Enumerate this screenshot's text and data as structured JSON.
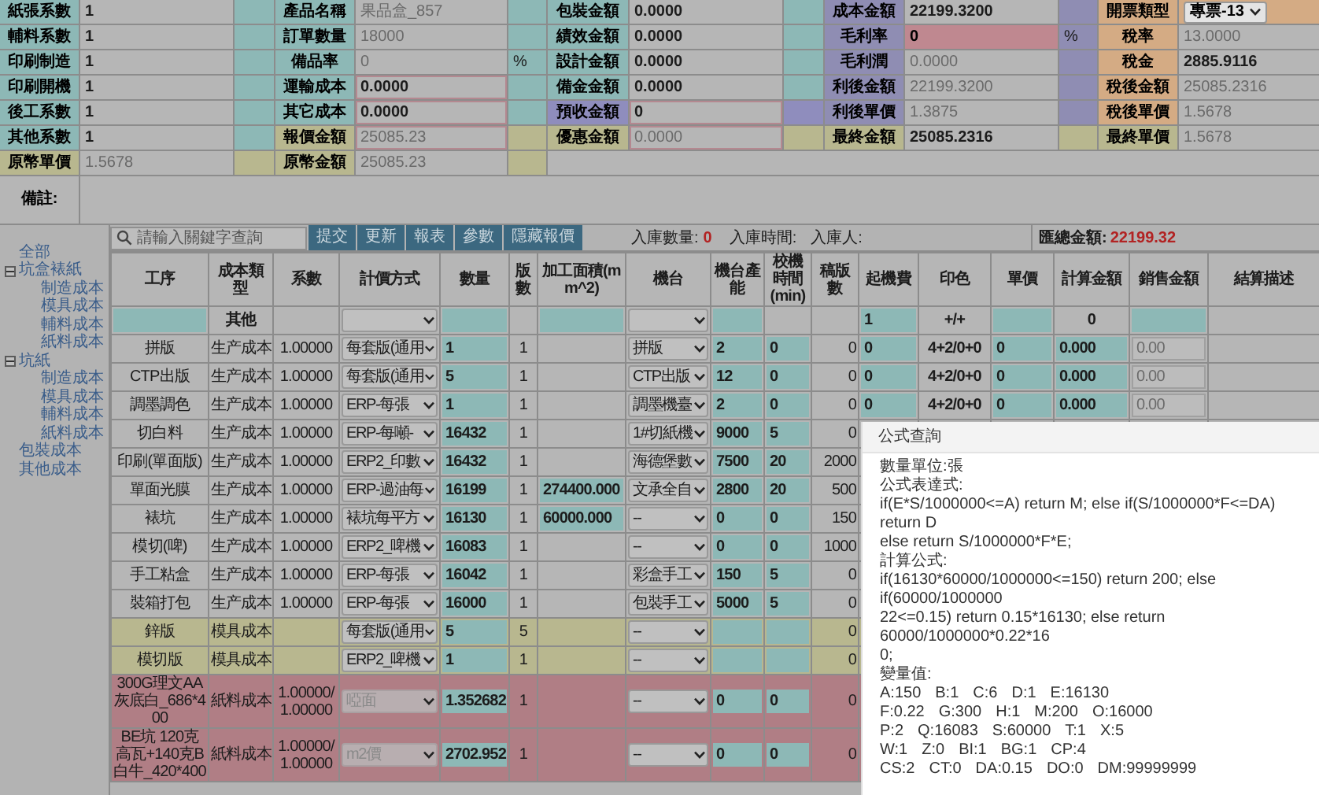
{
  "form": {
    "rows": [
      [
        {
          "label": "紙張系數",
          "kind": "basic",
          "value": "1",
          "readonly": false
        },
        {
          "label": "產品名稱",
          "kind": "basic",
          "value": "果品盒_857",
          "readonly": true
        },
        {
          "label": "包裝金額",
          "kind": "basic",
          "value": "0.0000",
          "readonly": false
        },
        {
          "label": "成本金額",
          "kind": "profit",
          "value": "22199.3200",
          "readonly": false
        },
        {
          "label": "開票類型",
          "kind": "tax",
          "value": "專票-13",
          "readonly": false,
          "dropdown": true
        }
      ],
      [
        {
          "label": "輔料系數",
          "kind": "basic",
          "value": "1",
          "readonly": false
        },
        {
          "label": "訂單數量",
          "kind": "basic",
          "value": "18000",
          "readonly": true
        },
        {
          "label": "績效金額",
          "kind": "basic",
          "value": "0.0000",
          "readonly": false
        },
        {
          "label": "毛利率",
          "kind": "profit",
          "value": "0",
          "readonly": false,
          "alert": true,
          "unit": "%"
        },
        {
          "label": "稅率",
          "kind": "tax",
          "value": "13.0000",
          "readonly": true
        }
      ],
      [
        {
          "label": "印刷制造",
          "kind": "basic",
          "value": "1",
          "readonly": false
        },
        {
          "label": "備品率",
          "kind": "basic",
          "value": "0",
          "readonly": true,
          "unit": "%"
        },
        {
          "label": "設計金額",
          "kind": "basic",
          "value": "0.0000",
          "readonly": false
        },
        {
          "label": "毛利潤",
          "kind": "profit",
          "value": "0.0000",
          "readonly": true
        },
        {
          "label": "稅金",
          "kind": "tax",
          "value": "2885.9116",
          "readonly": false
        }
      ],
      [
        {
          "label": "印刷開機",
          "kind": "basic",
          "value": "1",
          "readonly": false
        },
        {
          "label": "運輸成本",
          "kind": "basic",
          "value": "0.0000",
          "readonly": false,
          "bordered": true
        },
        {
          "label": "備金金額",
          "kind": "basic",
          "value": "0.0000",
          "readonly": false
        },
        {
          "label": "利後金額",
          "kind": "profit",
          "value": "22199.3200",
          "readonly": true
        },
        {
          "label": "稅後金額",
          "kind": "tax",
          "value": "25085.2316",
          "readonly": true
        }
      ],
      [
        {
          "label": "後工系數",
          "kind": "basic",
          "value": "1",
          "readonly": false
        },
        {
          "label": "其它成本",
          "kind": "basic",
          "value": "0.0000",
          "readonly": false,
          "bordered": true
        },
        {
          "label": "預收金額",
          "kind": "prepaid",
          "value": "0",
          "readonly": false,
          "bordered": true
        },
        {
          "label": "利後單價",
          "kind": "profit",
          "value": "1.3875",
          "readonly": true
        },
        {
          "label": "稅後單價",
          "kind": "tax",
          "value": "1.5678",
          "readonly": true
        }
      ],
      [
        {
          "label": "其他系數",
          "kind": "basic",
          "value": "1",
          "readonly": false
        },
        {
          "label": "報價金額",
          "kind": "final",
          "value": "25085.23",
          "readonly": true,
          "bordered": true
        },
        {
          "label": "優惠金額",
          "kind": "final",
          "value": "0.0000",
          "readonly": true,
          "bordered": true
        },
        {
          "label": "最終金額",
          "kind": "final",
          "value": "25085.2316",
          "readonly": false
        },
        {
          "label": "最終單價",
          "kind": "final",
          "value": "1.5678",
          "readonly": true
        }
      ],
      [
        {
          "label": "原幣單價",
          "kind": "final",
          "value": "1.5678",
          "readonly": true
        },
        {
          "label": "原幣金額",
          "kind": "final",
          "value": "25085.23",
          "readonly": true
        }
      ]
    ],
    "remark_label": "備註:"
  },
  "sidebar": {
    "tree": [
      {
        "label": "全部"
      },
      {
        "label": "坑盒裱紙",
        "expanded": true,
        "children": [
          {
            "label": "制造成本"
          },
          {
            "label": "模具成本"
          },
          {
            "label": "輔料成本"
          },
          {
            "label": "紙料成本"
          }
        ]
      },
      {
        "label": "坑紙",
        "expanded": true,
        "children": [
          {
            "label": "制造成本"
          },
          {
            "label": "模具成本"
          },
          {
            "label": "輔料成本"
          },
          {
            "label": "紙料成本"
          }
        ]
      },
      {
        "label": "包裝成本"
      },
      {
        "label": "其他成本"
      }
    ]
  },
  "toolbar": {
    "search": {
      "placeholder": "請輸入關鍵字查詢"
    },
    "buttons": [
      "提交",
      "更新",
      "報表",
      "參數",
      "隱藏報價"
    ],
    "stock_quantity_label": "入庫數量:",
    "stock_quantity": "0",
    "stock_time_label": "入庫時間:",
    "stock_person_label": "入庫人:",
    "total_label": "匯總金額:",
    "total": "22199.32"
  },
  "table": {
    "columns": [
      "工序",
      "成本類型",
      "系數",
      "計價方式",
      "數量",
      "版數",
      "加工面積(mm^2)",
      "機台",
      "機台產能",
      "校機時間(min)",
      "稿版數",
      "起機費",
      "印色",
      "單價",
      "計算金額",
      "銷售金額",
      "結算描述"
    ],
    "filter_row": {
      "cost_type": "其他",
      "start_fee": "1",
      "print_colors": "+/+",
      "calc_amount": "0"
    },
    "rows": [
      {
        "kind": "production",
        "process": "拼版",
        "cost_type": "生产成本",
        "coefficient": "1.00000",
        "pricing_method": "每套版(通用",
        "pricing_disabled": false,
        "quantity": "1",
        "plates": "1",
        "machine": "拼版",
        "capacity": "2",
        "setup_time": "0",
        "draft_plates": "0",
        "start_fee": "0",
        "print_colors": "4+2/0+0",
        "unit_price": "0",
        "calc_amount": "0.000",
        "sales_amount": "0.00"
      },
      {
        "kind": "production",
        "process": "CTP出版",
        "cost_type": "生产成本",
        "coefficient": "1.00000",
        "pricing_method": "每套版(通用",
        "pricing_disabled": false,
        "quantity": "5",
        "plates": "1",
        "machine": "CTP出版",
        "capacity": "12",
        "setup_time": "0",
        "draft_plates": "0",
        "start_fee": "0",
        "print_colors": "4+2/0+0",
        "unit_price": "0",
        "calc_amount": "0.000",
        "sales_amount": "0.00"
      },
      {
        "kind": "production",
        "process": "調墨調色",
        "cost_type": "生产成本",
        "coefficient": "1.00000",
        "pricing_method": "ERP-每張",
        "pricing_disabled": false,
        "quantity": "1",
        "plates": "1",
        "machine": "調墨機臺",
        "capacity": "2",
        "setup_time": "0",
        "draft_plates": "0",
        "start_fee": "0",
        "print_colors": "4+2/0+0",
        "unit_price": "0",
        "calc_amount": "0.000",
        "sales_amount": "0.00"
      },
      {
        "kind": "production",
        "process": "切白料",
        "cost_type": "生产成本",
        "coefficient": "1.00000",
        "pricing_method": "ERP-每噸-",
        "pricing_disabled": false,
        "quantity": "16432",
        "plates": "1",
        "machine": "1#切紙機",
        "capacity": "9000",
        "setup_time": "5",
        "draft_plates": "0"
      },
      {
        "kind": "production",
        "process": "印刷(單面版)",
        "cost_type": "生产成本",
        "coefficient": "1.00000",
        "pricing_method": "ERP2_印數",
        "pricing_disabled": false,
        "quantity": "16432",
        "plates": "1",
        "machine": "海德堡數",
        "capacity": "7500",
        "setup_time": "20",
        "draft_plates": "2000"
      },
      {
        "kind": "production",
        "process": "單面光膜",
        "cost_type": "生产成本",
        "coefficient": "1.00000",
        "pricing_method": "ERP-過油每",
        "pricing_disabled": false,
        "quantity": "16199",
        "plates": "1",
        "area": "274400.000",
        "machine": "文承全自",
        "capacity": "2800",
        "setup_time": "20",
        "draft_plates": "500"
      },
      {
        "kind": "production",
        "process": "裱坑",
        "cost_type": "生产成本",
        "coefficient": "1.00000",
        "pricing_method": "裱坑每平方",
        "pricing_disabled": false,
        "quantity": "16130",
        "plates": "1",
        "area": "60000.000",
        "machine": "--",
        "capacity": "0",
        "setup_time": "0",
        "draft_plates": "150"
      },
      {
        "kind": "production",
        "process": "模切(啤)",
        "cost_type": "生产成本",
        "coefficient": "1.00000",
        "pricing_method": "ERP2_啤機",
        "pricing_disabled": false,
        "quantity": "16083",
        "plates": "1",
        "machine": "--",
        "capacity": "0",
        "setup_time": "0",
        "draft_plates": "1000"
      },
      {
        "kind": "production",
        "process": "手工粘盒",
        "cost_type": "生产成本",
        "coefficient": "1.00000",
        "pricing_method": "ERP-每張",
        "pricing_disabled": false,
        "quantity": "16042",
        "plates": "1",
        "machine": "彩盒手工",
        "capacity": "150",
        "setup_time": "5",
        "draft_plates": "0"
      },
      {
        "kind": "production",
        "process": "裝箱打包",
        "cost_type": "生产成本",
        "coefficient": "1.00000",
        "pricing_method": "ERP-每張",
        "pricing_disabled": false,
        "quantity": "16000",
        "plates": "1",
        "machine": "包裝手工",
        "capacity": "5000",
        "setup_time": "5",
        "draft_plates": "0"
      },
      {
        "kind": "mold",
        "process": "鋅版",
        "cost_type": "模具成本",
        "pricing_method": "每套版(通用",
        "pricing_disabled": false,
        "quantity": "5",
        "plates": "5",
        "machine": "--",
        "draft_plates": "0"
      },
      {
        "kind": "mold",
        "process": "模切版",
        "cost_type": "模具成本",
        "pricing_method": "ERP2_啤機",
        "pricing_disabled": false,
        "quantity": "1",
        "plates": "1",
        "machine": "--",
        "draft_plates": "0"
      },
      {
        "kind": "paper",
        "process": "300G理文AA灰底白_686*400",
        "cost_type": "紙料成本",
        "coefficient": "1.00000/1.00000",
        "pricing_method": "啞面",
        "pricing_disabled": true,
        "quantity": "1.352682",
        "plates": "1",
        "machine": "--",
        "capacity": "0",
        "setup_time": "0",
        "draft_plates": "0"
      },
      {
        "kind": "paper",
        "process": "BE坑 120克高瓦+140克B白牛_420*400",
        "cost_type": "紙料成本",
        "coefficient": "1.00000/1.00000",
        "pricing_method": "m2價",
        "pricing_disabled": true,
        "quantity": "2702.952",
        "plates": "1",
        "machine": "--",
        "capacity": "0",
        "setup_time": "0",
        "draft_plates": "0"
      }
    ]
  },
  "dialog": {
    "title": "公式查詢",
    "lines": [
      "數量單位:張",
      "公式表達式:",
      "if(E*S/1000000<=A) return M; else if(S/1000000*F<=DA) return D",
      "else return S/1000000*F*E;",
      "計算公式:",
      "if(16130*60000/1000000<=150) return 200; else if(60000/1000000",
      "22<=0.15) return 0.15*16130; else return 60000/1000000*0.22*16",
      "0;",
      "變量值:"
    ],
    "variables": [
      [
        "A:150",
        "B:1",
        "C:6",
        "D:1",
        "E:16130"
      ],
      [
        "F:0.22",
        "G:300",
        "H:1",
        "M:200",
        "O:16000"
      ],
      [
        "P:2",
        "Q:16083",
        "S:60000",
        "T:1",
        "X:5"
      ],
      [
        "W:1",
        "Z:0",
        "BI:1",
        "BG:1",
        "CP:4"
      ],
      [
        "CS:2",
        "CT:0",
        "DA:0.15",
        "DO:0",
        "DM:99999999"
      ]
    ]
  }
}
